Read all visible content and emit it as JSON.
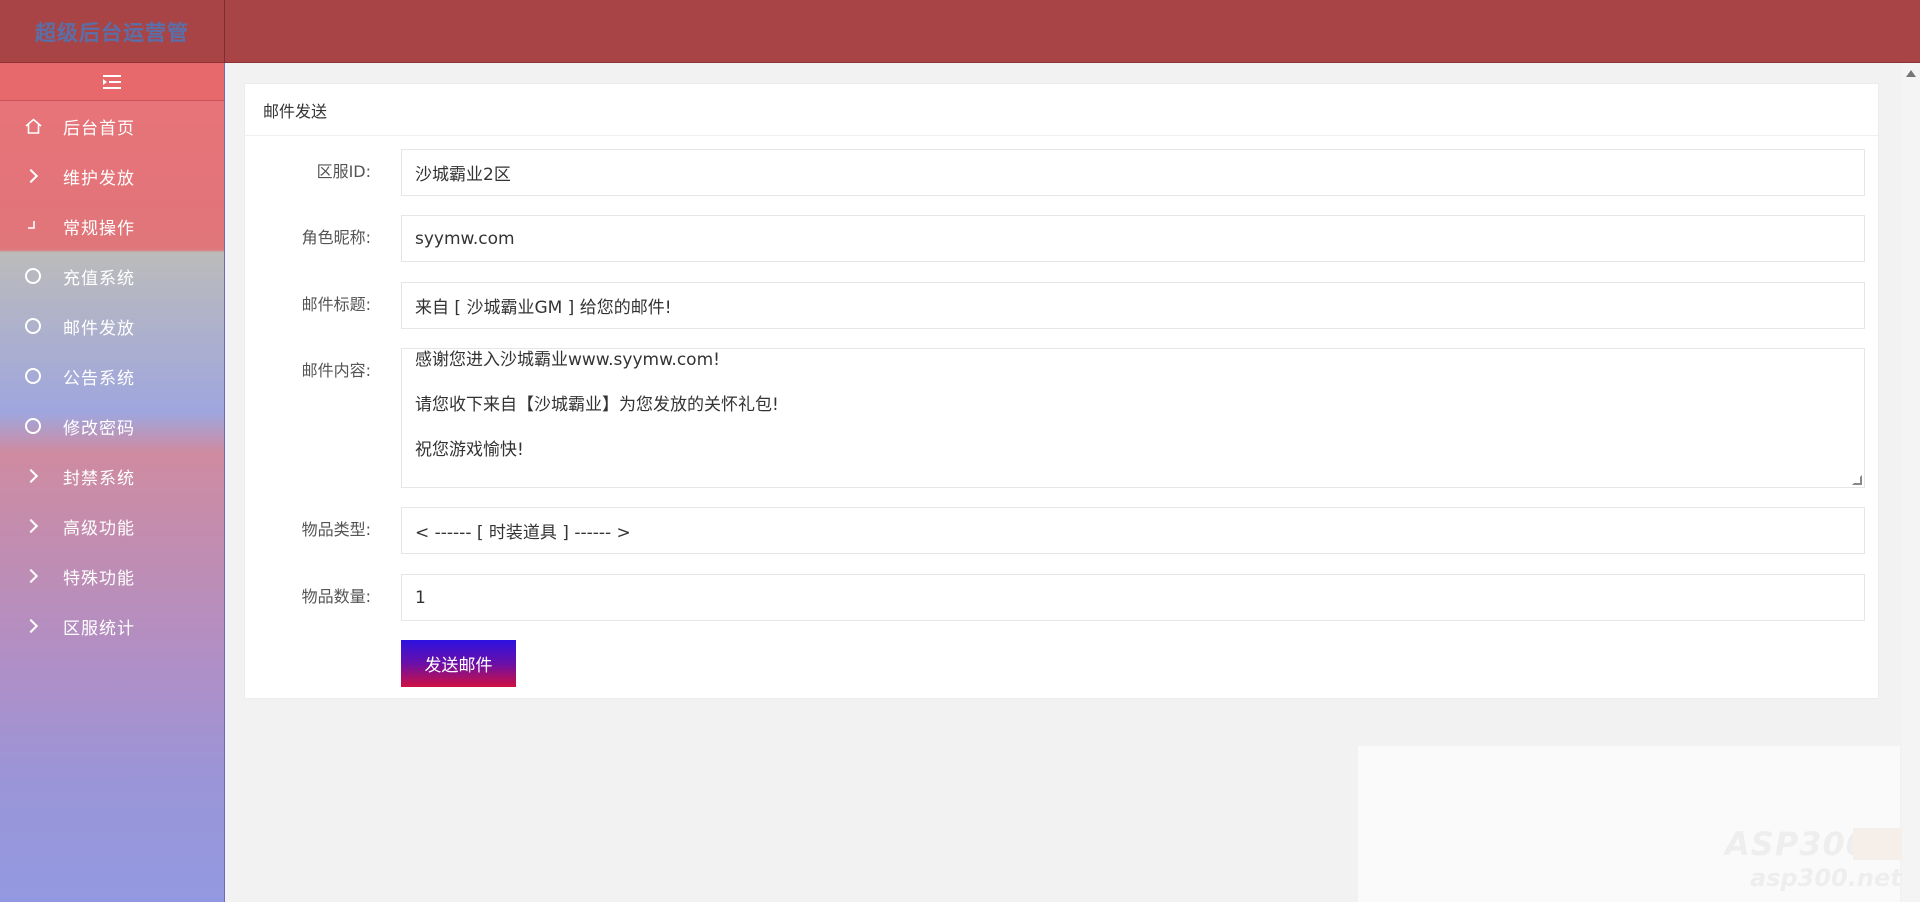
{
  "brand": {
    "title": "超级后台运营管"
  },
  "sidebar": {
    "toggle_icon": "menu-fold-icon",
    "items": [
      {
        "label": "后台首页",
        "icon": "home-icon"
      },
      {
        "label": "维护发放",
        "icon": "chevron-right-icon"
      },
      {
        "label": "常规操作",
        "icon": "corner-icon"
      },
      {
        "label": "充值系统",
        "icon": "circle-icon"
      },
      {
        "label": "邮件发放",
        "icon": "circle-icon"
      },
      {
        "label": "公告系统",
        "icon": "circle-icon"
      },
      {
        "label": "修改密码",
        "icon": "circle-icon"
      },
      {
        "label": "封禁系统",
        "icon": "chevron-right-icon"
      },
      {
        "label": "高级功能",
        "icon": "chevron-right-icon"
      },
      {
        "label": "特殊功能",
        "icon": "chevron-right-icon"
      },
      {
        "label": "区服统计",
        "icon": "chevron-right-icon"
      }
    ]
  },
  "panel": {
    "title": "邮件发送",
    "fields": {
      "server": {
        "label": "区服ID:",
        "value": "沙城霸业2区"
      },
      "role": {
        "label": "角色昵称:",
        "value": "syymw.com"
      },
      "subject": {
        "label": "邮件标题:",
        "value": "来自 [ 沙城霸业GM ] 给您的邮件!"
      },
      "content": {
        "label": "邮件内容:",
        "lines": [
          "感谢您进入沙城霸业www.syymw.com!",
          "请您收下来自【沙城霸业】为您发放的关怀礼包!",
          "祝您游戏愉快!"
        ]
      },
      "item_type": {
        "label": "物品类型:",
        "value": "< ------ [ 时装道具 ] ------ >"
      },
      "item_count": {
        "label": "物品数量:",
        "value": "1"
      }
    },
    "send_label": "发送邮件"
  },
  "watermark": {
    "line1": "ASP300",
    "line2": "asp300.net"
  }
}
